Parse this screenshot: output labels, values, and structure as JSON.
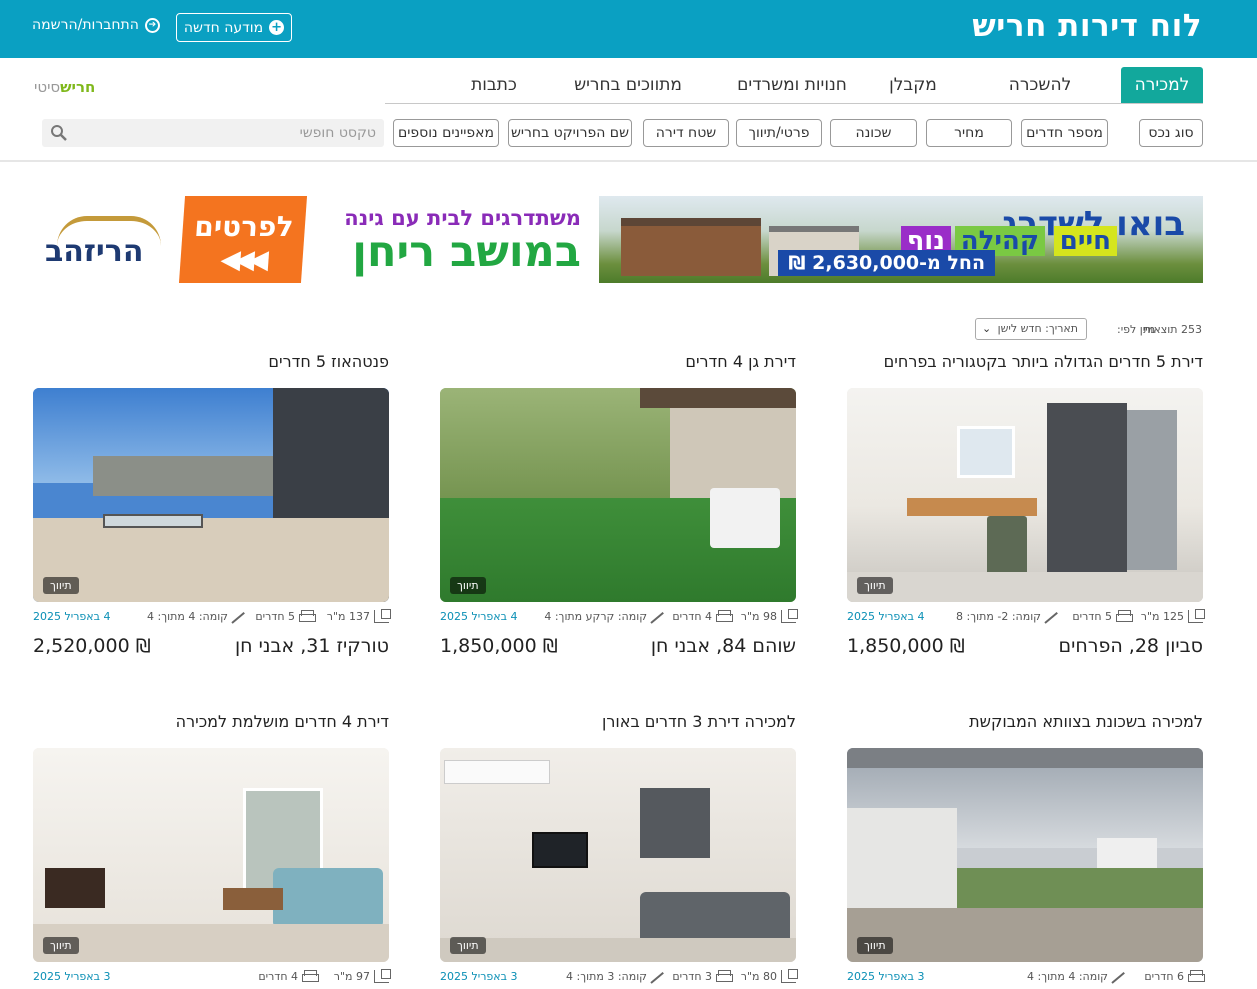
{
  "header": {
    "site_title": "לוח דירות חריש",
    "new_ad_label": "מודעה חדשה",
    "login_label": "התחברות/הרשמה"
  },
  "brand": {
    "bold": "חריש",
    "light": "סיטי"
  },
  "tabs": [
    {
      "label": "למכירה",
      "active": true
    },
    {
      "label": "להשכרה",
      "active": false
    },
    {
      "label": "מקבלן",
      "active": false
    },
    {
      "label": "חנויות ומשרדים",
      "active": false
    },
    {
      "label": "מתווכים בחריש",
      "active": false
    },
    {
      "label": "כתבות",
      "active": false
    }
  ],
  "filters": [
    "סוג נכס",
    "מספר חדרים",
    "מחיר",
    "שכונה",
    "פרטי/תיווך",
    "שטח דירה",
    "שם הפרויקט בחריש",
    "מאפיינים נוספים"
  ],
  "search": {
    "placeholder": "טקסט חופשי"
  },
  "banner": {
    "headline": "בואו לשדרג",
    "tags": [
      "חיים",
      "קהילה",
      "נוף"
    ],
    "price": "החל מ-2,630,000 ₪",
    "subtitle": "משתדרגים לבית עם גינה",
    "location": "במושב ריחן",
    "cta": "לפרטים",
    "logo_text": "הריזהב"
  },
  "results": {
    "count": "253 תוצאות",
    "sort_label": "מיין לפי:",
    "sort_value": "תאריך: חדש לישן"
  },
  "listings": [
    {
      "title": "דירת 5 חדרים הגדולה ביותר בקטגוריה בפרחים",
      "area": "125 מ\"ר",
      "rooms": "5 חדרים",
      "floor": "קומה: 2- מתוך: 8",
      "date": "4 באפריל 2025",
      "price": "₪ 1,850,000",
      "address": "סביון 28, הפרחים",
      "badge": "תיווך"
    },
    {
      "title": "דירת גן 4 חדרים",
      "area": "98 מ\"ר",
      "rooms": "4 חדרים",
      "floor": "קומה: קרקע מתוך: 4",
      "date": "4 באפריל 2025",
      "price": "₪ 1,850,000",
      "address": "שוהם 84, אבני חן",
      "badge": "תיווך"
    },
    {
      "title": "פנטהאוז 5 חדרים",
      "area": "137 מ\"ר",
      "rooms": "5 חדרים",
      "floor": "קומה: 4 מתוך: 4",
      "date": "4 באפריל 2025",
      "price": "₪ 2,520,000",
      "address": "טורקיז 31, אבני חן",
      "badge": "תיווך"
    },
    {
      "title": "למכירה בשכונת בצוותא המבוקשת",
      "area": "",
      "rooms": "6 חדרים",
      "floor": "קומה: 4 מתוך: 4",
      "date": "3 באפריל 2025",
      "price": "",
      "address": "",
      "badge": "תיווך"
    },
    {
      "title": "למכירה דירת 3 חדרים באורן",
      "area": "80 מ\"ר",
      "rooms": "3 חדרים",
      "floor": "קומה: 3 מתוך: 4",
      "date": "3 באפריל 2025",
      "price": "",
      "address": "",
      "badge": "תיווך"
    },
    {
      "title": "דירת 4 חדרים מושלמת למכירה",
      "area": "97 מ\"ר",
      "rooms": "4 חדרים",
      "floor": "",
      "date": "3 באפריל 2025",
      "price": "",
      "address": "",
      "badge": "תיווך"
    }
  ]
}
